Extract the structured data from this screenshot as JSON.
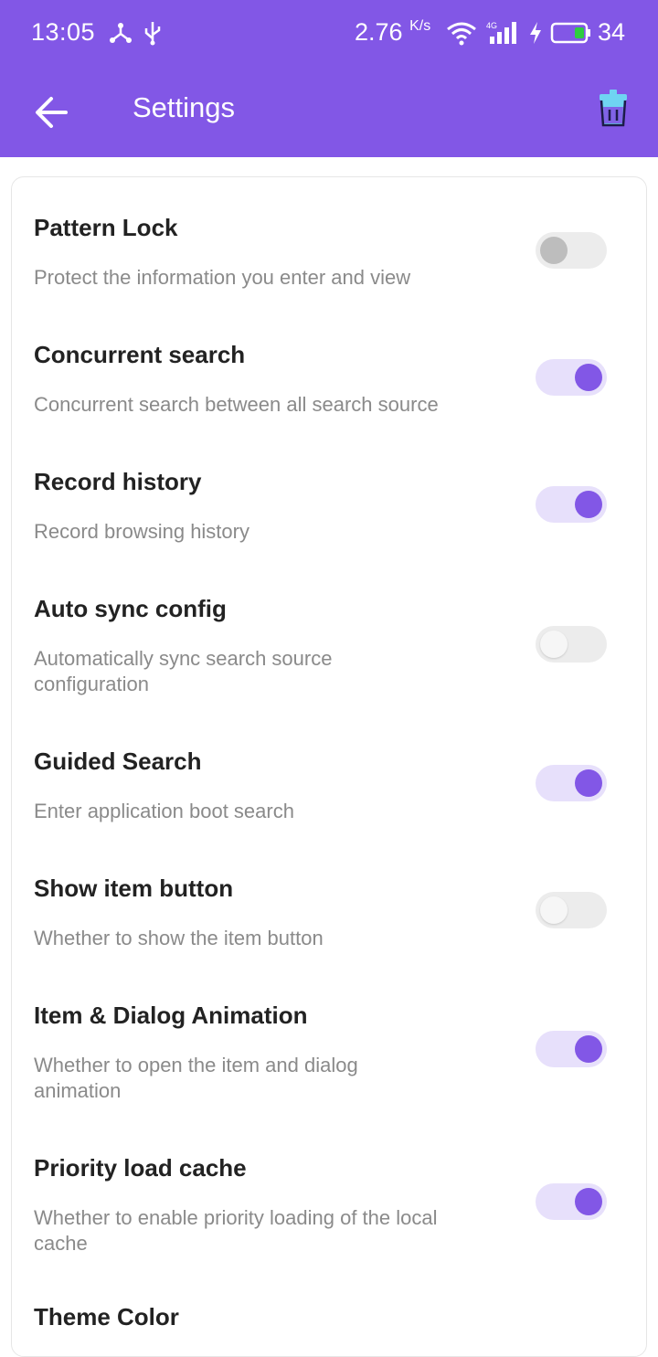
{
  "status_bar": {
    "time": "13:05",
    "speed": "2.76",
    "speed_unit": "K/s",
    "network": "4G",
    "battery": "34"
  },
  "app_bar": {
    "title": "Settings",
    "back_icon": "arrow-left-icon",
    "action_icon": "trash-icon"
  },
  "colors": {
    "accent": "#8257e6",
    "toggle_track_on": "#e7e0fb",
    "text_primary": "#222222",
    "text_secondary": "#8a8a8a"
  },
  "settings": [
    {
      "title": "Pattern Lock",
      "description": "Protect the information you enter and view",
      "enabled": false
    },
    {
      "title": "Concurrent search",
      "description": "Concurrent search between all search source",
      "enabled": true
    },
    {
      "title": "Record history",
      "description": "Record browsing history",
      "enabled": true
    },
    {
      "title": "Auto sync config",
      "description": "Automatically sync search source configuration",
      "enabled": false
    },
    {
      "title": "Guided Search",
      "description": "Enter application boot search",
      "enabled": true
    },
    {
      "title": "Show item button",
      "description": "Whether to show the item button",
      "enabled": false
    },
    {
      "title": "Item & Dialog Animation",
      "description": "Whether to open the item and dialog animation",
      "enabled": true
    },
    {
      "title": "Priority load cache",
      "description": "Whether to enable priority loading of the local cache",
      "enabled": true
    },
    {
      "title": "Theme Color",
      "description": "",
      "enabled": false
    }
  ]
}
